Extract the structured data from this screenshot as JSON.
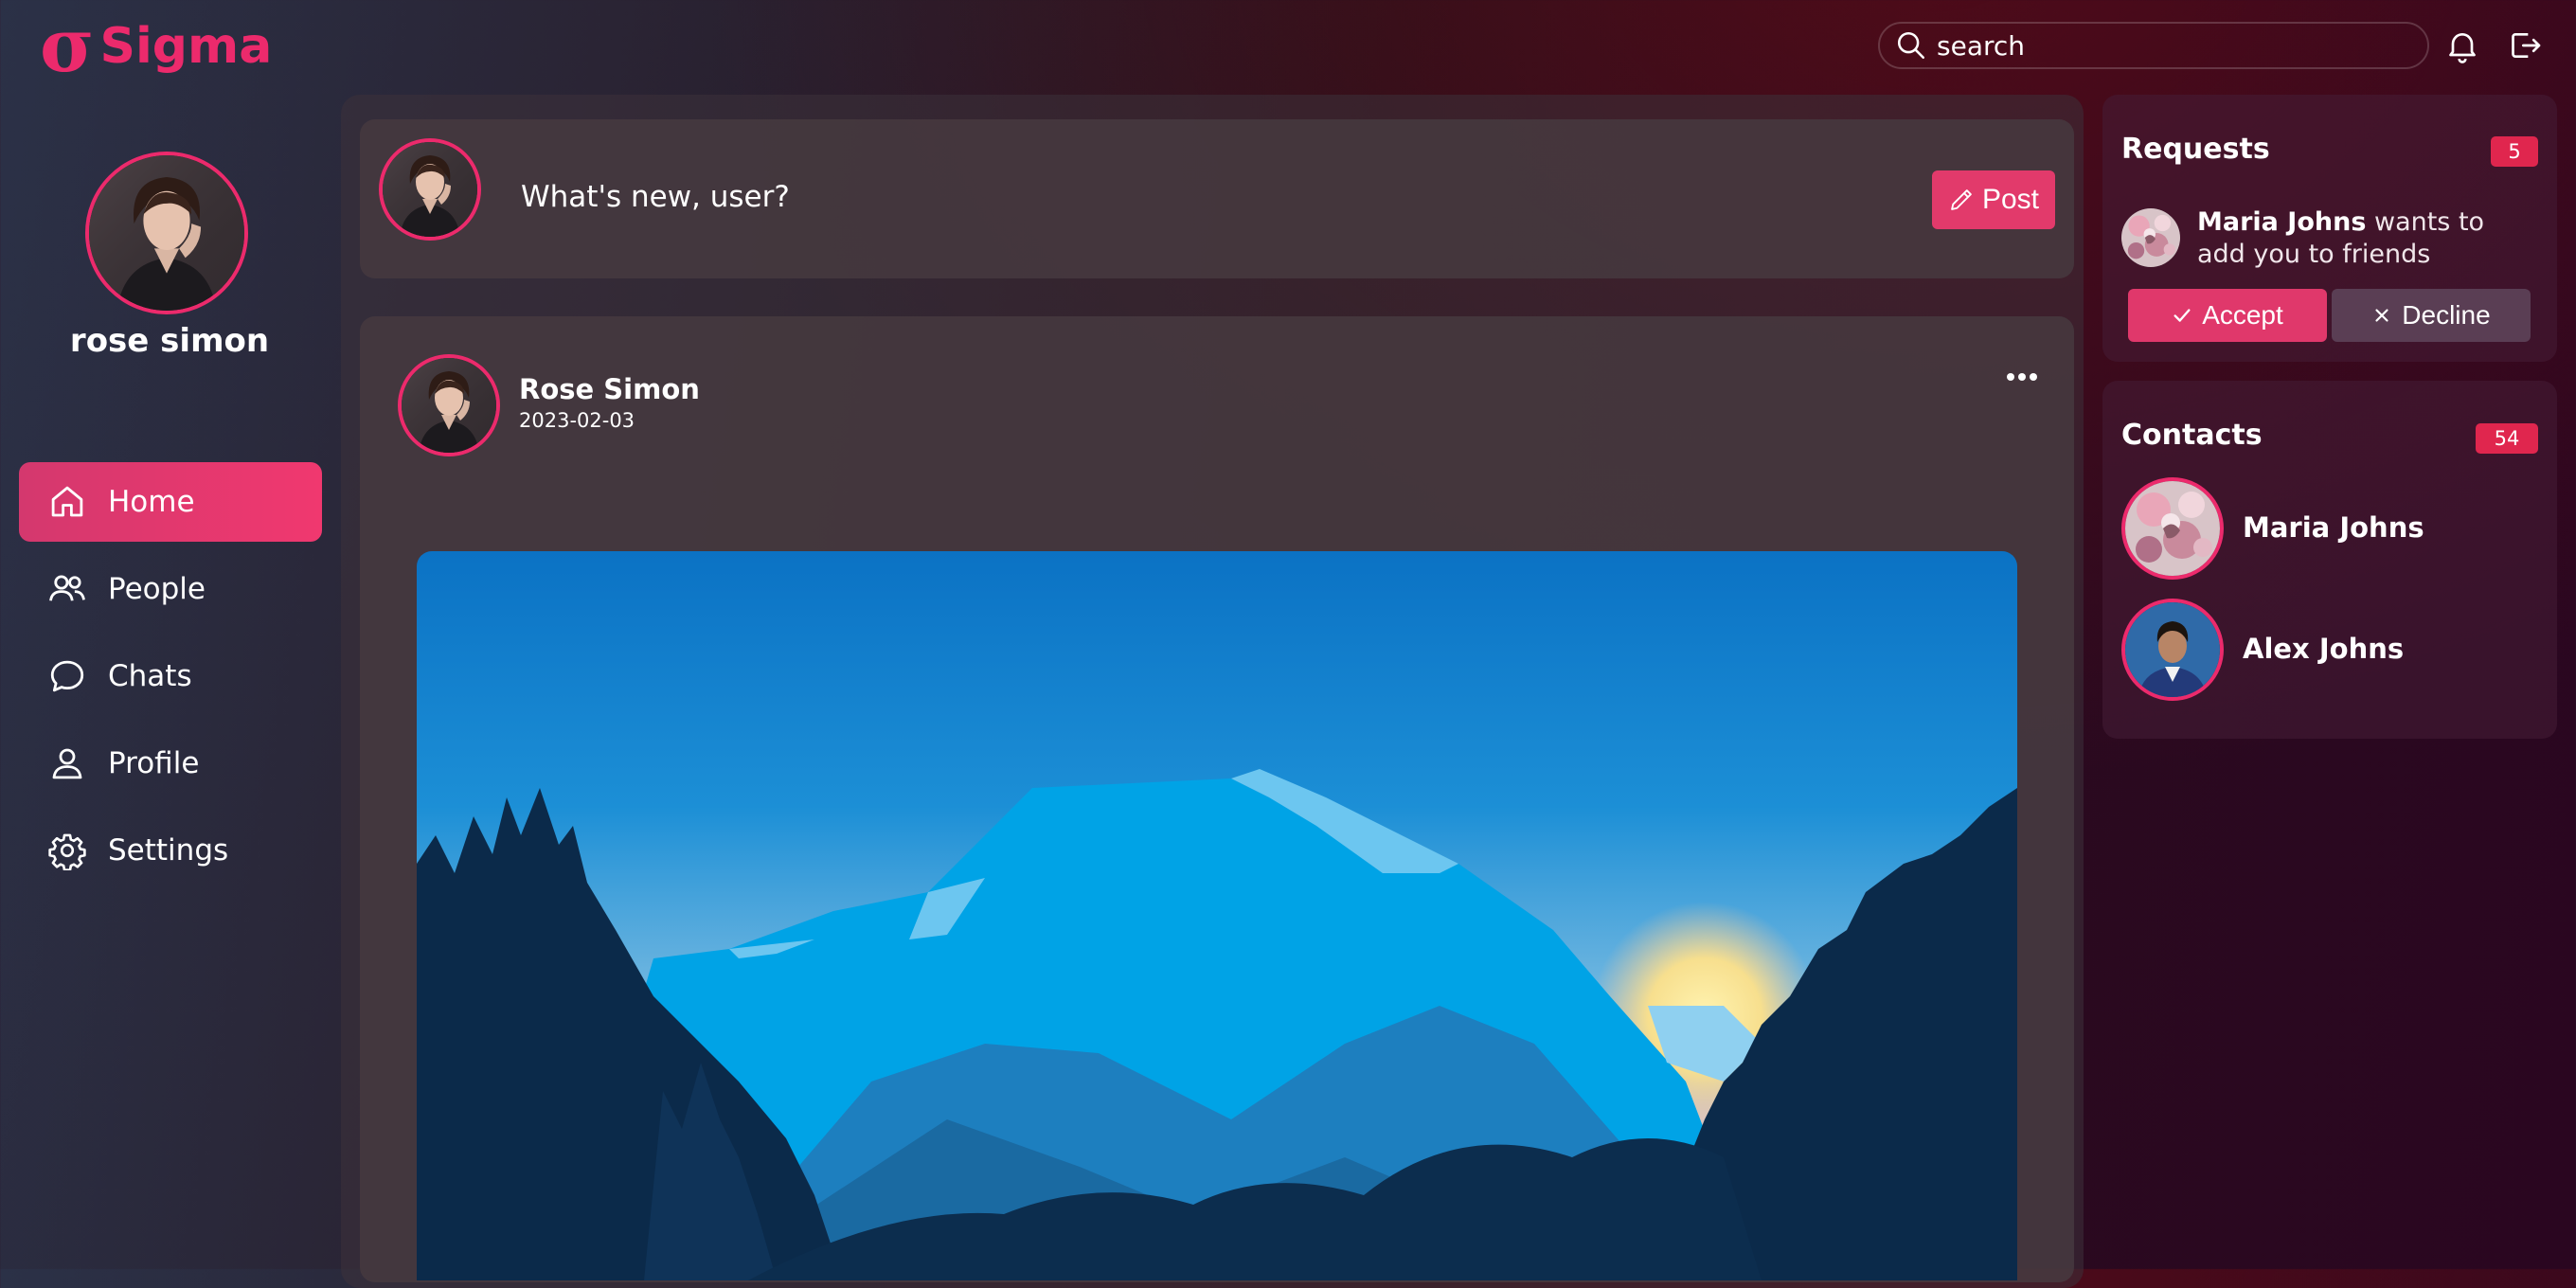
{
  "app": {
    "logo_mark": "σ",
    "name": "Sigma",
    "brand_color": "#ec2a6c"
  },
  "search": {
    "placeholder": "search"
  },
  "topbar": {
    "icons": [
      "bell-icon",
      "logout-icon"
    ]
  },
  "sidebar": {
    "user_name": "rose simon",
    "items": [
      {
        "label": "Home",
        "icon": "home-icon",
        "active": true
      },
      {
        "label": "People",
        "icon": "people-icon",
        "active": false
      },
      {
        "label": "Chats",
        "icon": "chat-icon",
        "active": false
      },
      {
        "label": "Profile",
        "icon": "user-icon",
        "active": false
      },
      {
        "label": "Settings",
        "icon": "gear-icon",
        "active": false
      }
    ]
  },
  "composer": {
    "prompt": "What's new, user?",
    "post_label": "Post"
  },
  "post": {
    "author": "Rose Simon",
    "date": "2023-02-03"
  },
  "requests": {
    "title": "Requests",
    "count": "5",
    "name": "Maria Johns",
    "message": "wants to add you to friends",
    "accept_label": "Accept",
    "decline_label": "Decline"
  },
  "contacts": {
    "title": "Contacts",
    "count": "54",
    "items": [
      {
        "name": "Maria Johns"
      },
      {
        "name": "Alex Johns"
      }
    ]
  }
}
